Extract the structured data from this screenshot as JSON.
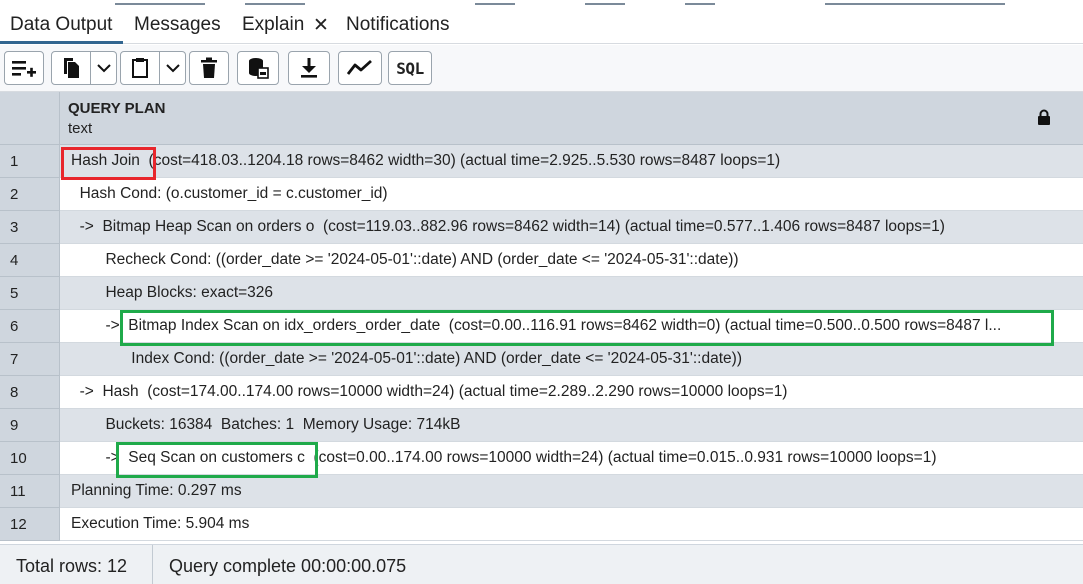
{
  "tabs": {
    "data_output": "Data Output",
    "messages": "Messages",
    "explain": "Explain",
    "explain_close": "✕",
    "notifications": "Notifications"
  },
  "toolbar": {
    "icons": [
      "add-row-icon",
      "copy-icon",
      "chevron-down-icon",
      "paste-icon",
      "chevron-down-icon",
      "delete-icon",
      "save-data-icon",
      "download-icon",
      "graph-visualiser-icon"
    ],
    "sql_label": "SQL"
  },
  "grid": {
    "column_name": "QUERY PLAN",
    "column_type": "text",
    "rows": [
      {
        "num": "1",
        "text": "Hash Join  (cost=418.03..1204.18 rows=8462 width=30) (actual time=2.925..5.530 rows=8487 loops=1)"
      },
      {
        "num": "2",
        "text": "  Hash Cond: (o.customer_id = c.customer_id)"
      },
      {
        "num": "3",
        "text": "  ->  Bitmap Heap Scan on orders o  (cost=119.03..882.96 rows=8462 width=14) (actual time=0.577..1.406 rows=8487 loops=1)"
      },
      {
        "num": "4",
        "text": "        Recheck Cond: ((order_date >= '2024-05-01'::date) AND (order_date <= '2024-05-31'::date))"
      },
      {
        "num": "5",
        "text": "        Heap Blocks: exact=326"
      },
      {
        "num": "6",
        "text": "        ->  Bitmap Index Scan on idx_orders_order_date  (cost=0.00..116.91 rows=8462 width=0) (actual time=0.500..0.500 rows=8487 l..."
      },
      {
        "num": "7",
        "text": "              Index Cond: ((order_date >= '2024-05-01'::date) AND (order_date <= '2024-05-31'::date))"
      },
      {
        "num": "8",
        "text": "  ->  Hash  (cost=174.00..174.00 rows=10000 width=24) (actual time=2.289..2.290 rows=10000 loops=1)"
      },
      {
        "num": "9",
        "text": "        Buckets: 16384  Batches: 1  Memory Usage: 714kB"
      },
      {
        "num": "10",
        "text": "        ->  Seq Scan on customers c  (cost=0.00..174.00 rows=10000 width=24) (actual time=0.015..0.931 rows=10000 loops=1)"
      },
      {
        "num": "11",
        "text": "Planning Time: 0.297 ms"
      },
      {
        "num": "12",
        "text": "Execution Time: 5.904 ms"
      }
    ]
  },
  "footer": {
    "total_rows": "Total rows: 12",
    "query_status": "Query complete 00:00:00.075"
  },
  "colors": {
    "accent": "#326690",
    "highlight_red": "#e8262c",
    "highlight_green": "#1faa4a",
    "row_stripe": "#dde2e8",
    "header_bg": "#cfd6de"
  }
}
